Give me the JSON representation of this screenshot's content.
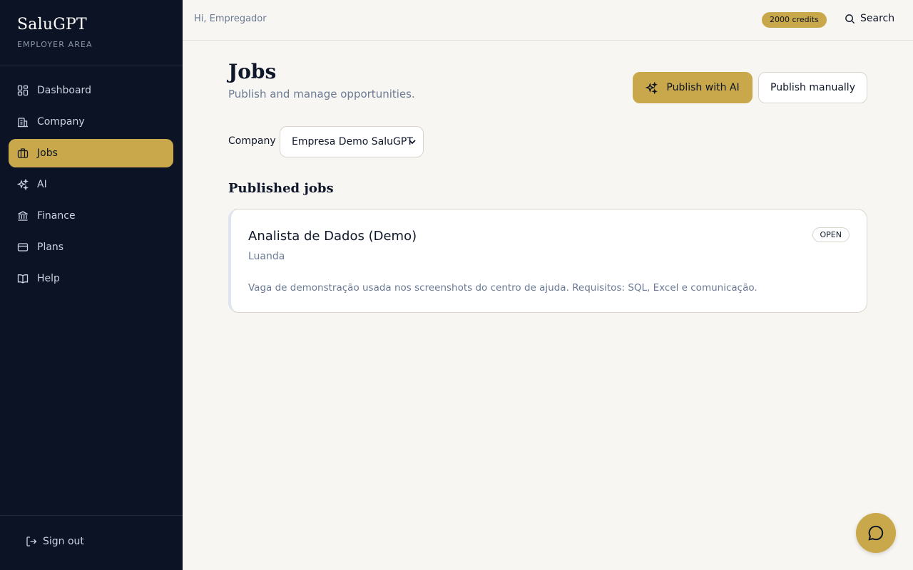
{
  "colors": {
    "sidebar_bg": "#0b1324",
    "accent": "#c9a84b",
    "page_bg": "#f8f6f2",
    "muted_text": "#6b7a93"
  },
  "sidebar": {
    "brand": "SaluGPT",
    "subtitle": "EMPLOYER AREA",
    "items": [
      {
        "label": "Dashboard",
        "icon": "grid-icon"
      },
      {
        "label": "Company",
        "icon": "building-icon"
      },
      {
        "label": "Jobs",
        "icon": "briefcase-icon",
        "active": true
      },
      {
        "label": "AI",
        "icon": "sparkles-icon"
      },
      {
        "label": "Finance",
        "icon": "bank-icon"
      },
      {
        "label": "Plans",
        "icon": "credit-card-icon"
      },
      {
        "label": "Help",
        "icon": "book-icon"
      }
    ],
    "signout_label": "Sign out"
  },
  "topbar": {
    "greeting": "Hi, Empregador",
    "credits": "2000 credits",
    "search_label": "Search"
  },
  "main": {
    "title": "Jobs",
    "subtitle": "Publish and manage opportunities.",
    "publish_ai_label": "Publish with AI",
    "publish_manual_label": "Publish manually",
    "company_label": "Company",
    "company_selected": "Empresa Demo SaluGPT",
    "section_title": "Published jobs",
    "jobs": [
      {
        "title": "Analista de Dados (Demo)",
        "location": "Luanda",
        "description": "Vaga de demonstração usada nos screenshots do centro de ajuda. Requisitos: SQL, Excel e comunicação.",
        "status": "OPEN"
      }
    ]
  }
}
